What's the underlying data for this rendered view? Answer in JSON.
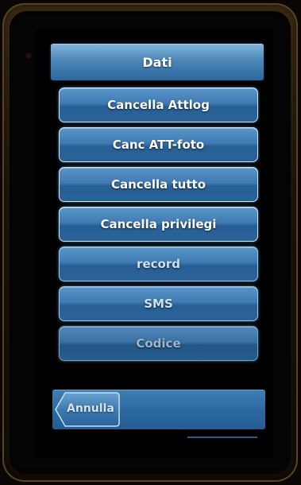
{
  "header": {
    "title": "Dati"
  },
  "menu": {
    "items": [
      {
        "label": "Cancella Attlog"
      },
      {
        "label": "Canc ATT-foto"
      },
      {
        "label": "Cancella tutto"
      },
      {
        "label": "Cancella privilegi"
      },
      {
        "label": "record"
      },
      {
        "label": "SMS"
      },
      {
        "label": "Codice"
      }
    ]
  },
  "footer": {
    "back_label": "Annulla"
  },
  "colors": {
    "accent": "#3f7bb3",
    "header": "#4c87b6",
    "text": "#ffffff"
  }
}
